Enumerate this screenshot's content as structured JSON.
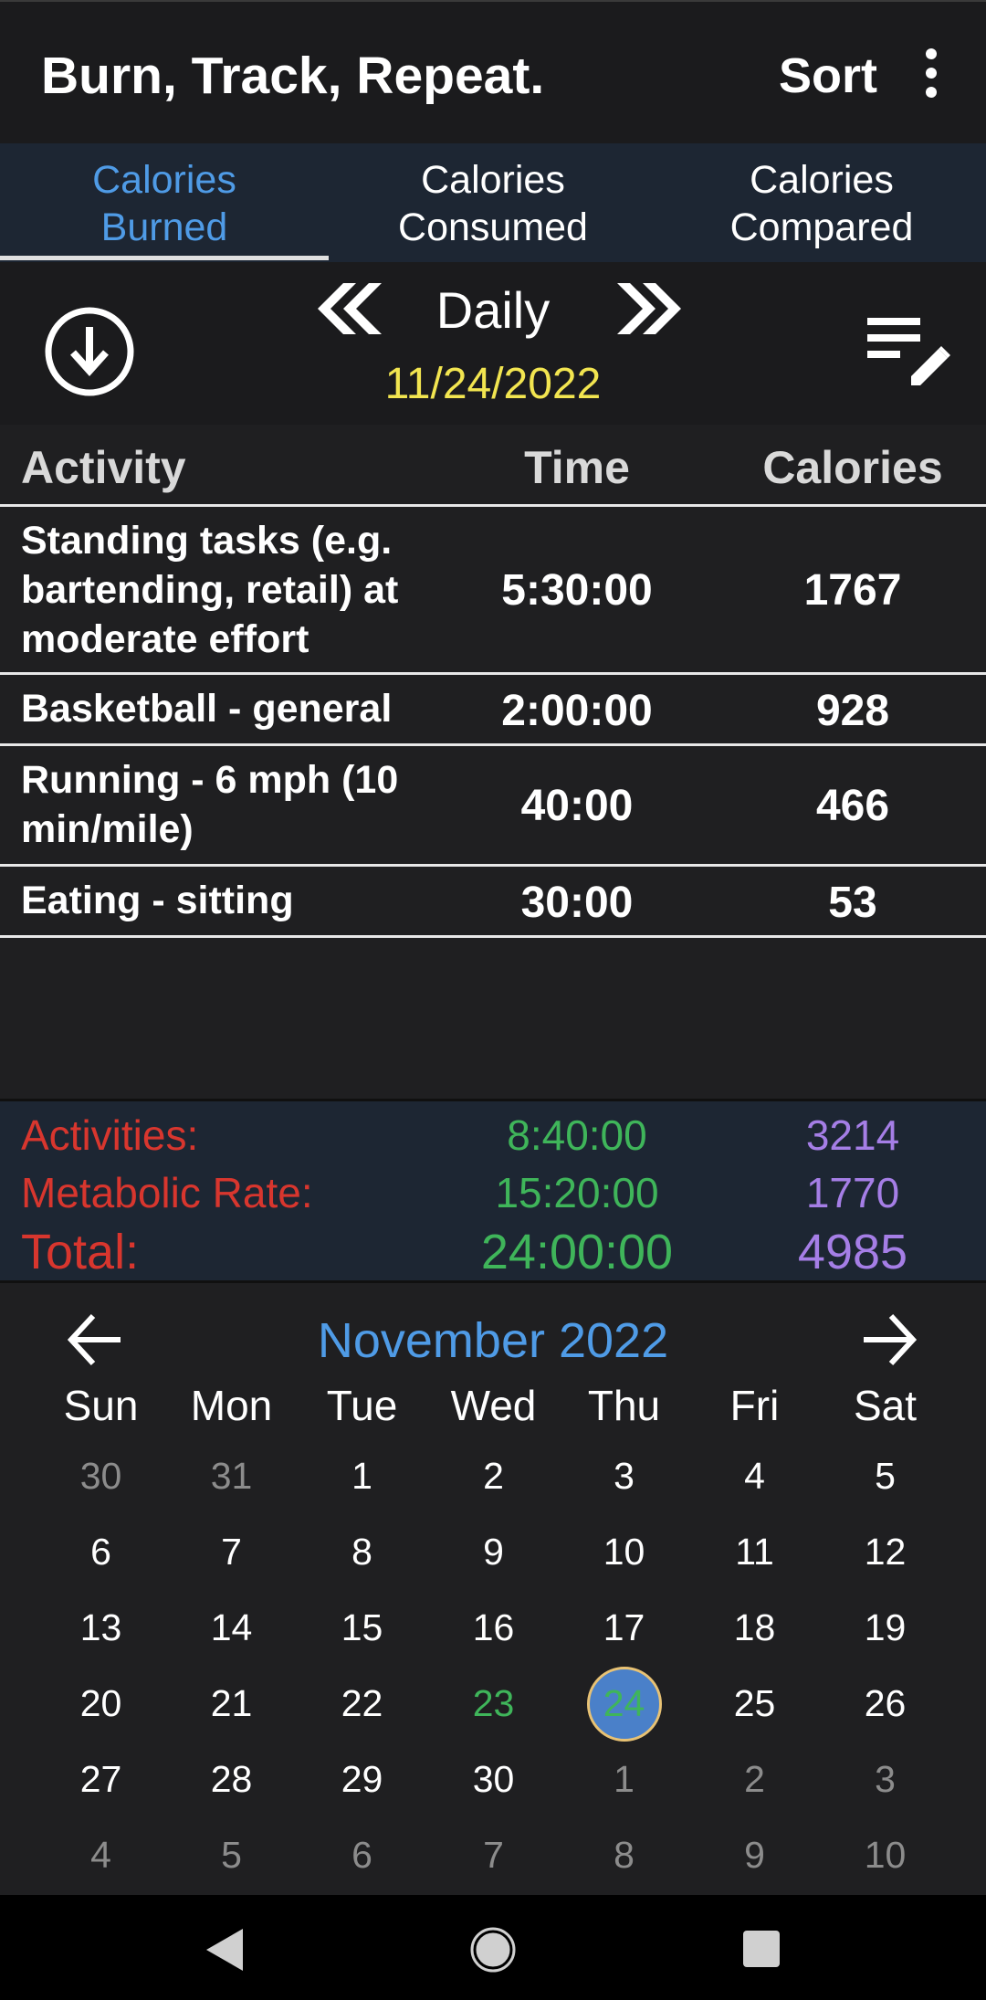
{
  "app": {
    "title": "Burn, Track, Repeat.",
    "sort_label": "Sort"
  },
  "tabs": [
    {
      "line1": "Calories",
      "line2": "Burned",
      "active": true
    },
    {
      "line1": "Calories",
      "line2": "Consumed",
      "active": false
    },
    {
      "line1": "Calories",
      "line2": "Compared",
      "active": false
    }
  ],
  "period": {
    "label": "Daily",
    "date": "11/24/2022"
  },
  "table": {
    "headers": {
      "activity": "Activity",
      "time": "Time",
      "calories": "Calories"
    },
    "rows": [
      {
        "activity": "Standing tasks (e.g. bartending, retail) at moderate effort",
        "time": "5:30:00",
        "calories": "1767"
      },
      {
        "activity": "Basketball - general",
        "time": "2:00:00",
        "calories": "928"
      },
      {
        "activity": "Running - 6 mph (10 min/mile)",
        "time": "40:00",
        "calories": "466"
      },
      {
        "activity": "Eating - sitting",
        "time": "30:00",
        "calories": "53"
      }
    ]
  },
  "summary": {
    "activities": {
      "label": "Activities:",
      "time": "8:40:00",
      "calories": "3214"
    },
    "metabolic": {
      "label": "Metabolic Rate:",
      "time": "15:20:00",
      "calories": "1770"
    },
    "total": {
      "label": "Total:",
      "time": "24:00:00",
      "calories": "4985"
    }
  },
  "calendar": {
    "month": "November 2022",
    "weekdays": [
      "Sun",
      "Mon",
      "Tue",
      "Wed",
      "Thu",
      "Fri",
      "Sat"
    ],
    "weeks": [
      [
        "30",
        "31",
        "1",
        "2",
        "3",
        "4",
        "5"
      ],
      [
        "6",
        "7",
        "8",
        "9",
        "10",
        "11",
        "12"
      ],
      [
        "13",
        "14",
        "15",
        "16",
        "17",
        "18",
        "19"
      ],
      [
        "20",
        "21",
        "22",
        "23",
        "24",
        "25",
        "26"
      ],
      [
        "27",
        "28",
        "29",
        "30",
        "1",
        "2",
        "3"
      ],
      [
        "4",
        "5",
        "6",
        "7",
        "8",
        "9",
        "10"
      ]
    ],
    "today": "23",
    "selected": "24"
  },
  "colors": {
    "accent_blue": "#4f9be6",
    "date_yellow": "#f2e550",
    "label_red": "#d8362e",
    "time_green": "#3fb55a",
    "calorie_purple": "#a57ee6"
  }
}
